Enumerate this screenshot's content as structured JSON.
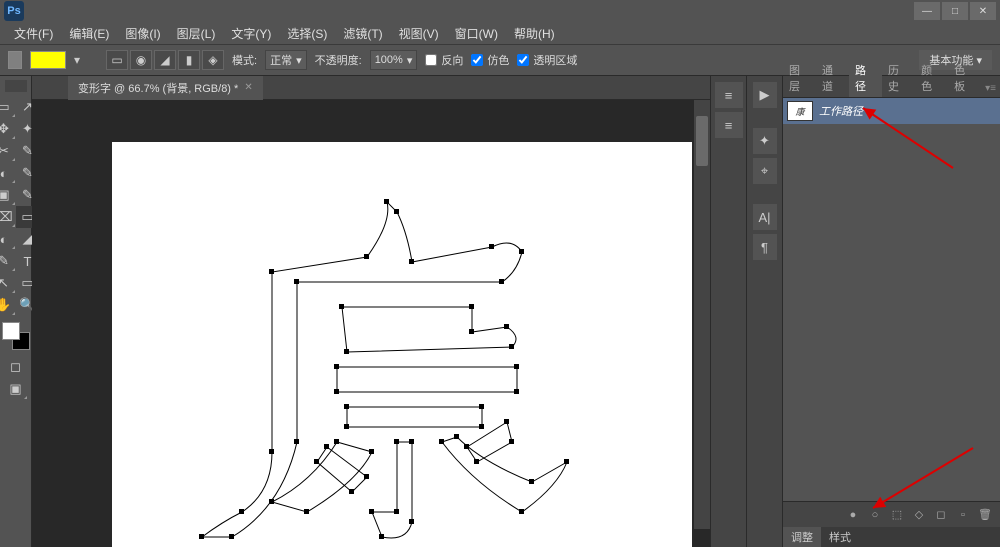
{
  "app": {
    "logo": "Ps"
  },
  "window_controls": {
    "min": "—",
    "max": "□",
    "close": "✕"
  },
  "menu": [
    "文件(F)",
    "编辑(E)",
    "图像(I)",
    "图层(L)",
    "文字(Y)",
    "选择(S)",
    "滤镜(T)",
    "视图(V)",
    "窗口(W)",
    "帮助(H)"
  ],
  "options": {
    "mode_label": "模式:",
    "mode_value": "正常",
    "opacity_label": "不透明度:",
    "opacity_value": "100%",
    "reverse": "反向",
    "dither": "仿色",
    "transparency": "透明区域",
    "workspace": "基本功能"
  },
  "document": {
    "tab_title": "变形字 @ 66.7% (背景, RGB/8) *"
  },
  "panels": {
    "tabs": [
      "图层",
      "通道",
      "路径",
      "历史",
      "颜色",
      "色板"
    ],
    "active_tab": "路径",
    "menu_glyph": "▾≡",
    "paths_items": [
      {
        "name": "工作路径",
        "thumb": "康"
      }
    ],
    "bottom_tabs": [
      "调整",
      "样式"
    ],
    "footer_icons": [
      "●",
      "○",
      "⬚",
      "◇",
      "◻",
      "▫",
      "🗑"
    ]
  },
  "mid_dock_icons": [
    "▶",
    "✦",
    "⌖",
    "A|",
    "¶"
  ],
  "extra_dock_icons": [
    "≡",
    "≡"
  ],
  "tools_left": [
    "▭",
    "⬚",
    "✥",
    "✂",
    "✎",
    "✦",
    "⌫",
    "◐",
    "⦿",
    "⟋",
    "✎",
    "T",
    "↖",
    "⬚",
    "✋",
    "🔍"
  ],
  "tools_left2": [
    "⬚",
    "◫",
    "◧",
    "◈",
    "✎",
    "✎",
    "▭",
    "⬚",
    "◐",
    "◢",
    "✎",
    "⬚",
    "⬚",
    "⬚",
    "⬚",
    "⬚"
  ]
}
